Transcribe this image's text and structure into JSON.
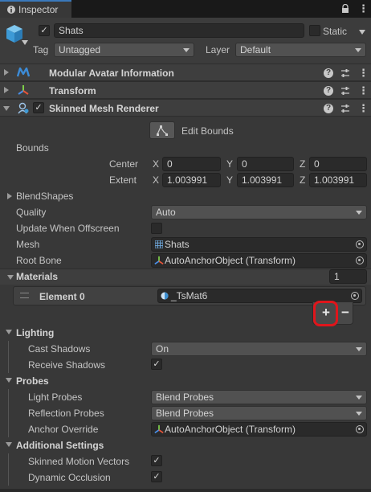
{
  "window": {
    "tab_label": "Inspector"
  },
  "header": {
    "object_name": "Shats",
    "static_label": "Static",
    "tag_label": "Tag",
    "tag_value": "Untagged",
    "layer_label": "Layer",
    "layer_value": "Default",
    "active_checked": true,
    "static_checked": false
  },
  "components": {
    "modular_avatar": "Modular Avatar Information",
    "transform": "Transform",
    "skinned_mesh_renderer": "Skinned Mesh Renderer"
  },
  "smr": {
    "edit_bounds_label": "Edit Bounds",
    "bounds_label": "Bounds",
    "center_label": "Center",
    "extent_label": "Extent",
    "axis_x": "X",
    "axis_y": "Y",
    "axis_z": "Z",
    "center": {
      "x": "0",
      "y": "0",
      "z": "0"
    },
    "extent": {
      "x": "1.003991",
      "y": "1.003991",
      "z": "1.003991"
    },
    "blendshapes_label": "BlendShapes",
    "quality_label": "Quality",
    "quality_value": "Auto",
    "update_offscreen_label": "Update When Offscreen",
    "mesh_label": "Mesh",
    "mesh_value": "Shats",
    "root_bone_label": "Root Bone",
    "root_bone_value": "AutoAnchorObject (Transform)"
  },
  "materials": {
    "label": "Materials",
    "count": "1",
    "element0_label": "Element 0",
    "element0_value": "_TsMat6",
    "add_symbol": "+",
    "remove_symbol": "−"
  },
  "lighting": {
    "label": "Lighting",
    "cast_shadows_label": "Cast Shadows",
    "cast_shadows_value": "On",
    "receive_shadows_label": "Receive Shadows"
  },
  "probes": {
    "label": "Probes",
    "light_probes_label": "Light Probes",
    "light_probes_value": "Blend Probes",
    "reflection_probes_label": "Reflection Probes",
    "reflection_probes_value": "Blend Probes",
    "anchor_override_label": "Anchor Override",
    "anchor_override_value": "AutoAnchorObject (Transform)"
  },
  "additional": {
    "label": "Additional Settings",
    "skinned_motion_vectors_label": "Skinned Motion Vectors",
    "dynamic_occlusion_label": "Dynamic Occlusion"
  },
  "icons": {
    "check": "✓",
    "more": "⋮",
    "help": "?"
  },
  "colors": {
    "background": "#383838",
    "highlight_ring": "#e0151b",
    "modular_avatar_icon": "#3c8cd8"
  }
}
